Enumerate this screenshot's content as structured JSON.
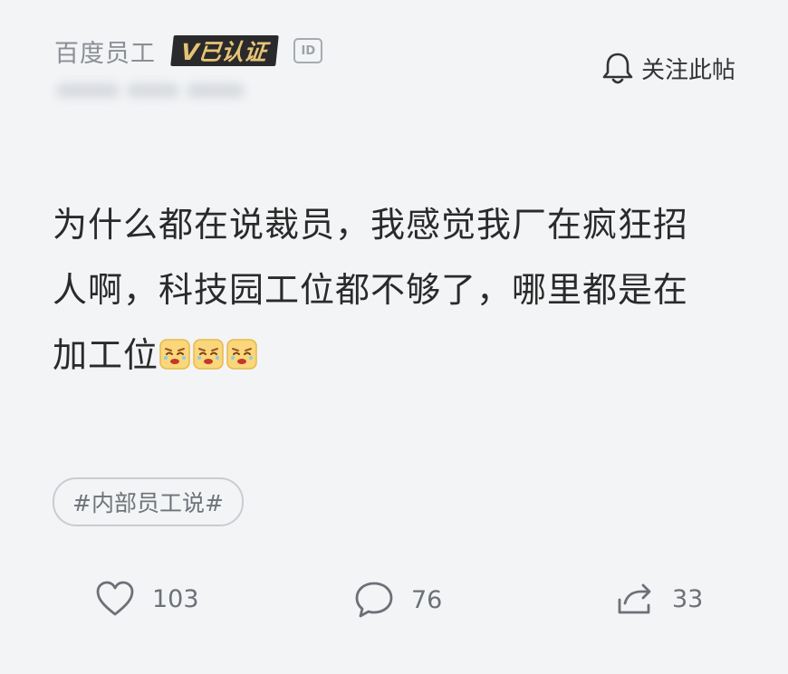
{
  "author": {
    "name": "百度员工",
    "verified_label": "V已认证",
    "id_badge": "ID"
  },
  "follow": {
    "label": "关注此帖",
    "icon": "bell-icon"
  },
  "post": {
    "text": "为什么都在说裁员，我感觉我厂在疯狂招人啊，科技园工位都不够了，哪里都是在加工位",
    "emoji": [
      "tired-face-emoji",
      "tired-face-emoji",
      "tired-face-emoji"
    ]
  },
  "tag": {
    "label": "#内部员工说#"
  },
  "actions": {
    "like_count": "103",
    "comment_count": "76",
    "share_count": "33"
  },
  "colors": {
    "background": "#f2f4f6",
    "badge_bg": "#2a2a2c",
    "badge_text": "#e6c476",
    "muted_text": "#8b8e94"
  }
}
